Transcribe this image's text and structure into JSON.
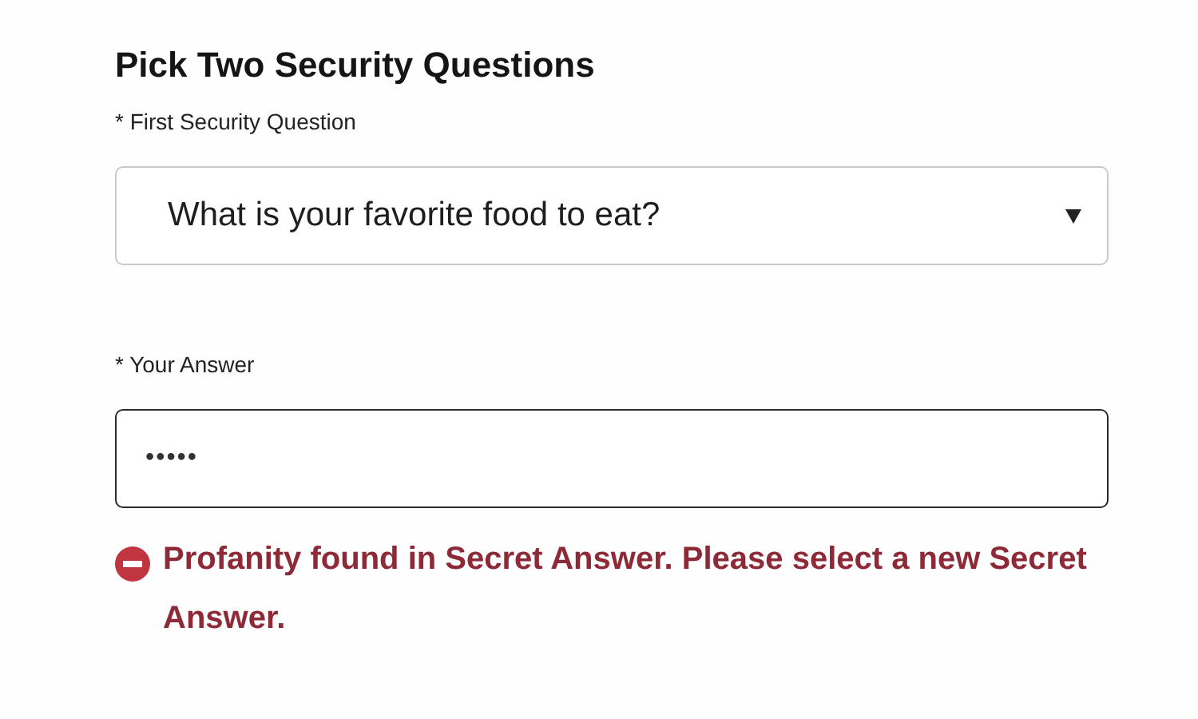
{
  "heading": "Pick Two Security Questions",
  "question": {
    "label": "* First Security Question",
    "value": "What is your favorite food to eat?"
  },
  "answer": {
    "label": "* Your Answer",
    "value": "•••••"
  },
  "error": "Profanity found in Secret Answer. Please select a new Secret Answer."
}
